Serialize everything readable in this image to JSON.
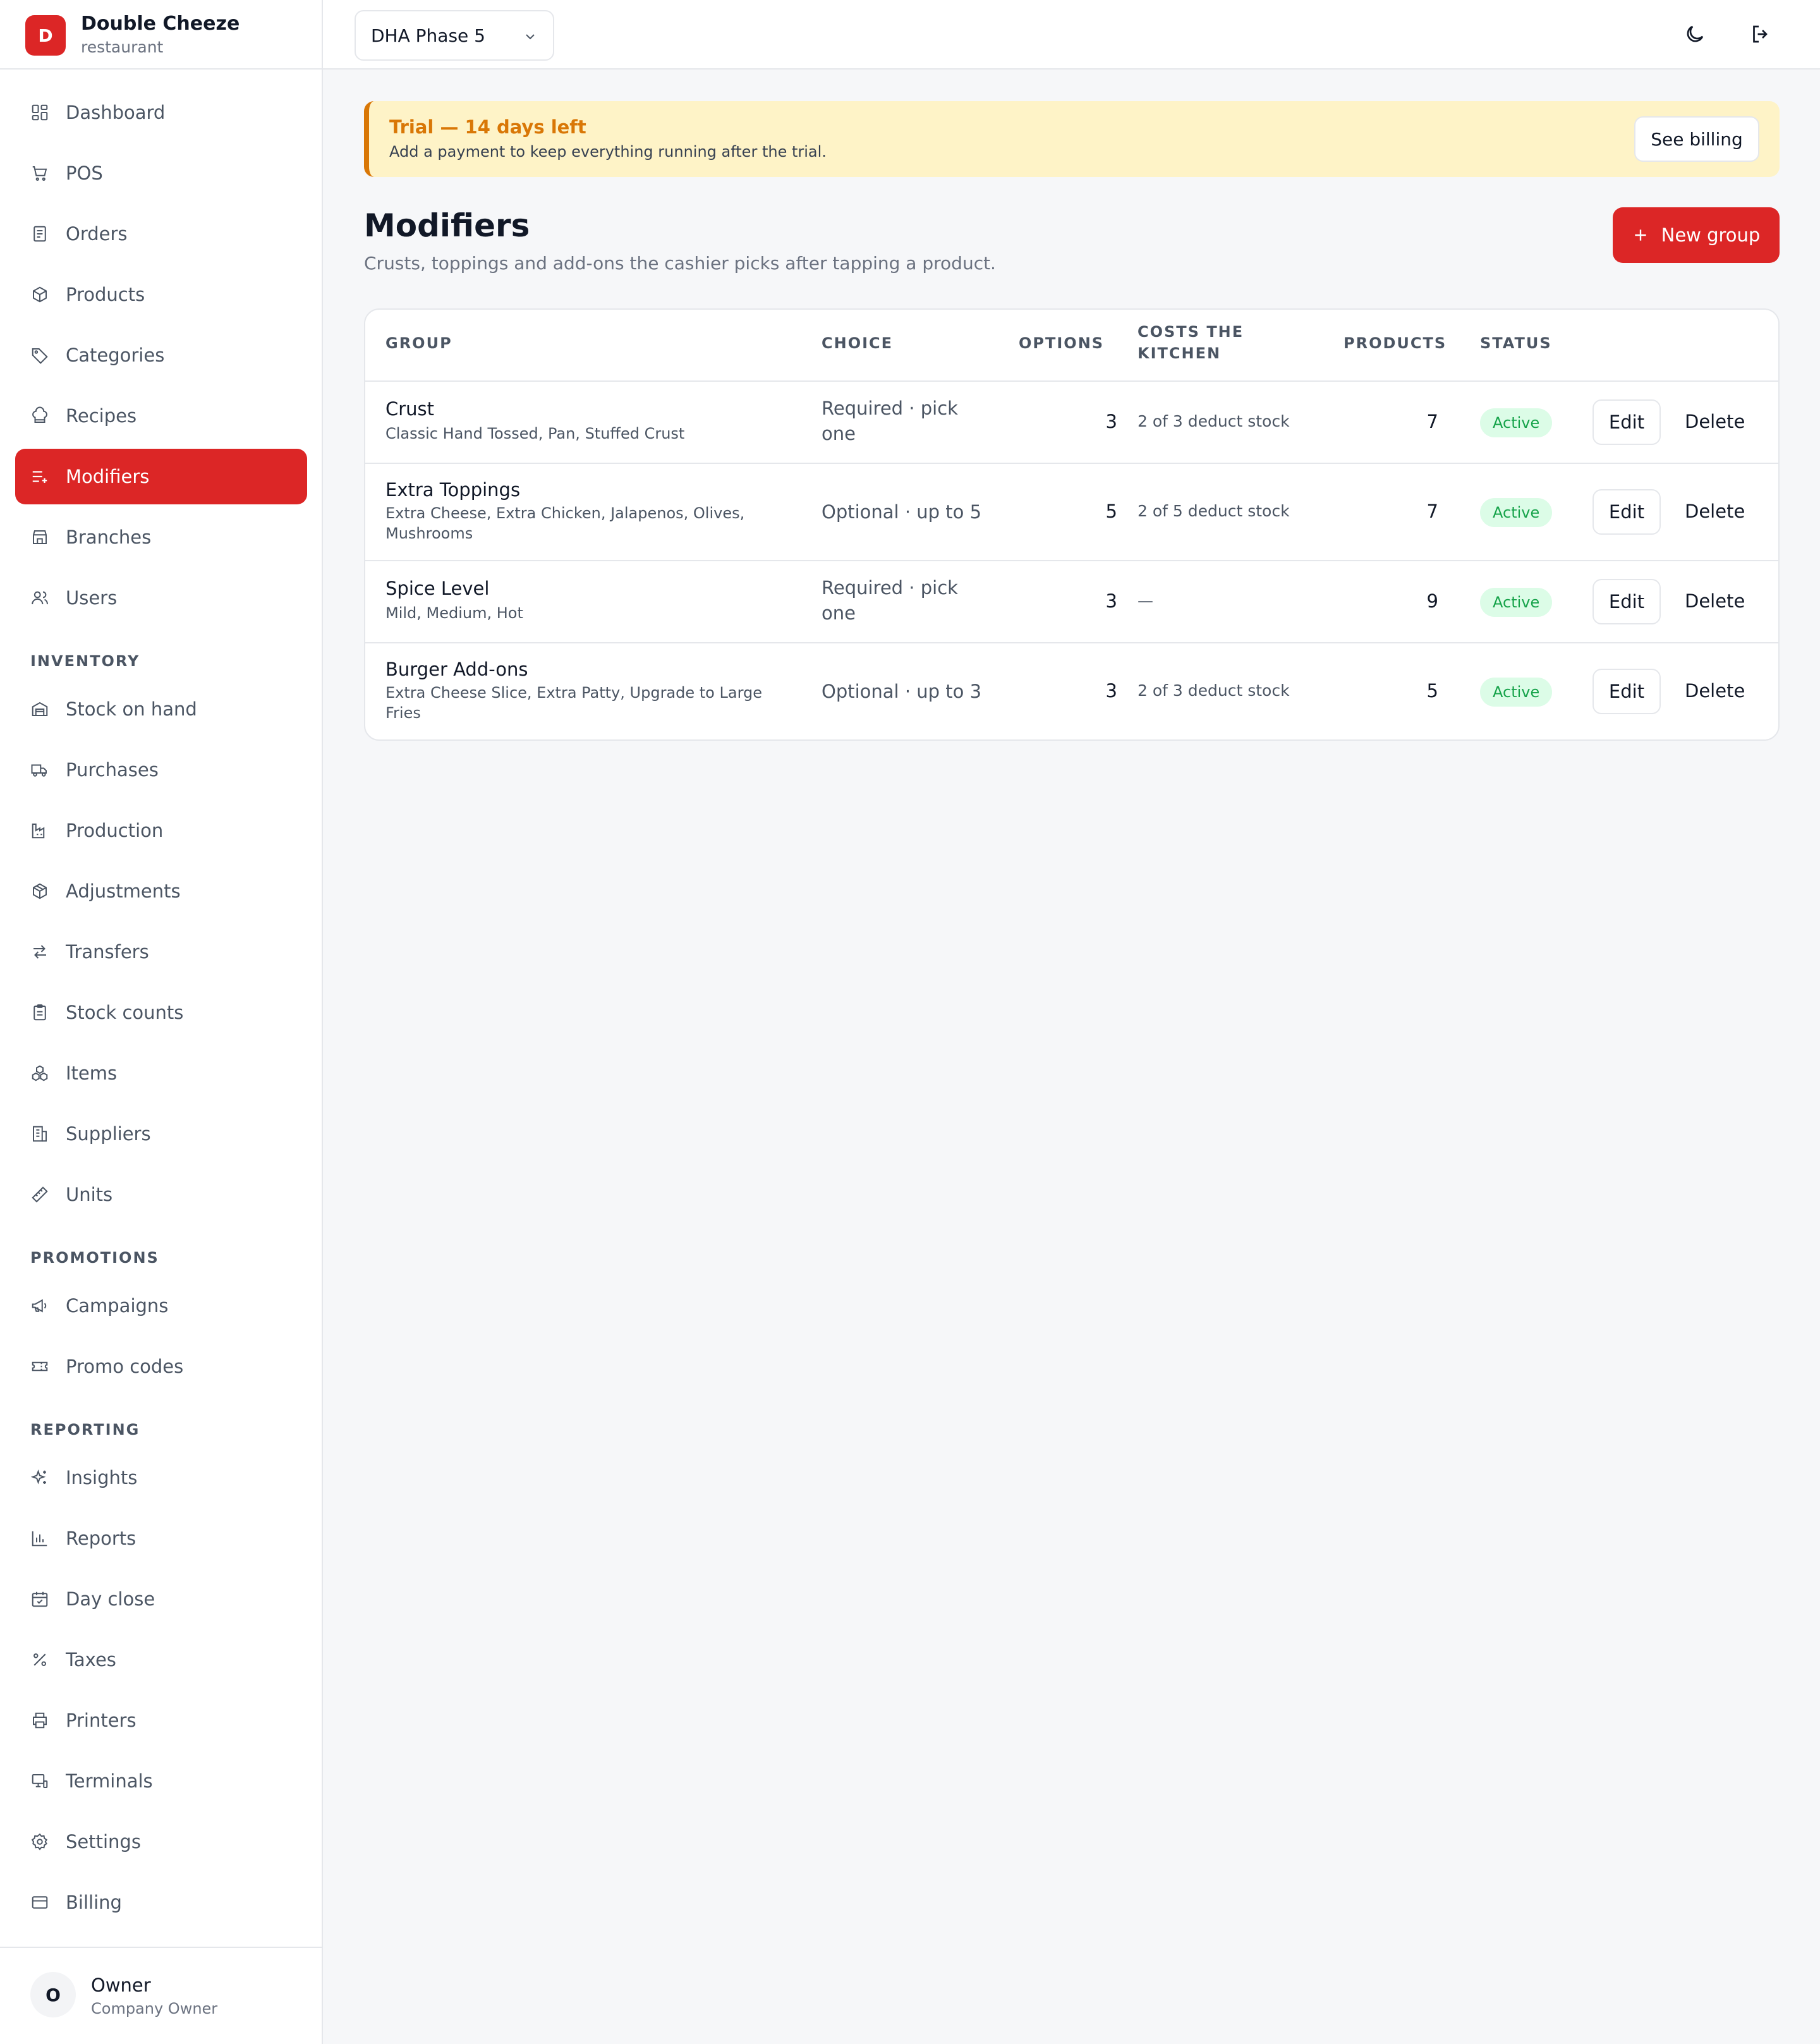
{
  "brand": {
    "initial": "D",
    "name": "Double Cheeze",
    "type": "restaurant"
  },
  "nav": {
    "main": [
      {
        "label": "Dashboard",
        "icon": "dashboard-icon"
      },
      {
        "label": "POS",
        "icon": "cart-icon"
      },
      {
        "label": "Orders",
        "icon": "receipt-icon"
      },
      {
        "label": "Products",
        "icon": "box-icon"
      },
      {
        "label": "Categories",
        "icon": "tag-icon"
      },
      {
        "label": "Recipes",
        "icon": "chef-hat-icon"
      },
      {
        "label": "Modifiers",
        "icon": "list-plus-icon",
        "active": true
      },
      {
        "label": "Branches",
        "icon": "store-icon"
      },
      {
        "label": "Users",
        "icon": "users-icon"
      }
    ],
    "inventory_label": "INVENTORY",
    "inventory": [
      {
        "label": "Stock on hand",
        "icon": "warehouse-icon"
      },
      {
        "label": "Purchases",
        "icon": "truck-icon"
      },
      {
        "label": "Production",
        "icon": "factory-icon"
      },
      {
        "label": "Adjustments",
        "icon": "package-icon"
      },
      {
        "label": "Transfers",
        "icon": "arrows-left-right-icon"
      },
      {
        "label": "Stock counts",
        "icon": "clipboard-icon"
      },
      {
        "label": "Items",
        "icon": "cubes-icon"
      },
      {
        "label": "Suppliers",
        "icon": "building-icon"
      },
      {
        "label": "Units",
        "icon": "ruler-icon"
      }
    ],
    "promotions_label": "PROMOTIONS",
    "promotions": [
      {
        "label": "Campaigns",
        "icon": "megaphone-icon"
      },
      {
        "label": "Promo codes",
        "icon": "ticket-icon"
      }
    ],
    "reporting_label": "REPORTING",
    "reporting": [
      {
        "label": "Insights",
        "icon": "sparkles-icon"
      },
      {
        "label": "Reports",
        "icon": "bar-chart-icon"
      },
      {
        "label": "Day close",
        "icon": "calendar-check-icon"
      },
      {
        "label": "Taxes",
        "icon": "percent-icon"
      },
      {
        "label": "Printers",
        "icon": "printer-icon"
      },
      {
        "label": "Terminals",
        "icon": "monitor-icon"
      },
      {
        "label": "Settings",
        "icon": "gear-icon"
      },
      {
        "label": "Billing",
        "icon": "credit-card-icon"
      }
    ]
  },
  "user": {
    "initial": "O",
    "name": "Owner",
    "role": "Company Owner"
  },
  "topbar": {
    "branch": "DHA Phase 5"
  },
  "trial": {
    "title": "Trial — 14 days left",
    "subtitle": "Add a payment to keep everything running after the trial.",
    "button": "See billing"
  },
  "page": {
    "title": "Modifiers",
    "subtitle": "Crusts, toppings and add-ons the cashier picks after tapping a product.",
    "new_button": "New group"
  },
  "table": {
    "headers": {
      "group": "GROUP",
      "choice": "CHOICE",
      "options": "OPTIONS",
      "costs_line1": "COSTS THE",
      "costs_line2": "KITCHEN",
      "products": "PRODUCTS",
      "status": "STATUS"
    },
    "rows": [
      {
        "name": "Crust",
        "items_line1": "Classic Hand Tossed, Pan, Stuffed Crust",
        "items_line2": "",
        "choice_line1": "Required · pick",
        "choice_line2": "one",
        "options": "3",
        "costs": "2 of 3 deduct stock",
        "products": "7",
        "status": "Active",
        "edit": "Edit",
        "delete": "Delete"
      },
      {
        "name": "Extra Toppings",
        "items_line1": "Extra Cheese, Extra Chicken, Jalapenos, Olives,",
        "items_line2": "Mushrooms",
        "choice_line1": "Optional · up to 5",
        "choice_line2": "",
        "options": "5",
        "costs": "2 of 5 deduct stock",
        "products": "7",
        "status": "Active",
        "edit": "Edit",
        "delete": "Delete"
      },
      {
        "name": "Spice Level",
        "items_line1": "Mild, Medium, Hot",
        "items_line2": "",
        "choice_line1": "Required · pick",
        "choice_line2": "one",
        "options": "3",
        "costs": "—",
        "products": "9",
        "status": "Active",
        "edit": "Edit",
        "delete": "Delete"
      },
      {
        "name": "Burger Add-ons",
        "items_line1": "Extra Cheese Slice, Extra Patty, Upgrade to Large",
        "items_line2": "Fries",
        "choice_line1": "Optional · up to 3",
        "choice_line2": "",
        "options": "3",
        "costs": "2 of 3 deduct stock",
        "products": "5",
        "status": "Active",
        "edit": "Edit",
        "delete": "Delete"
      }
    ]
  }
}
